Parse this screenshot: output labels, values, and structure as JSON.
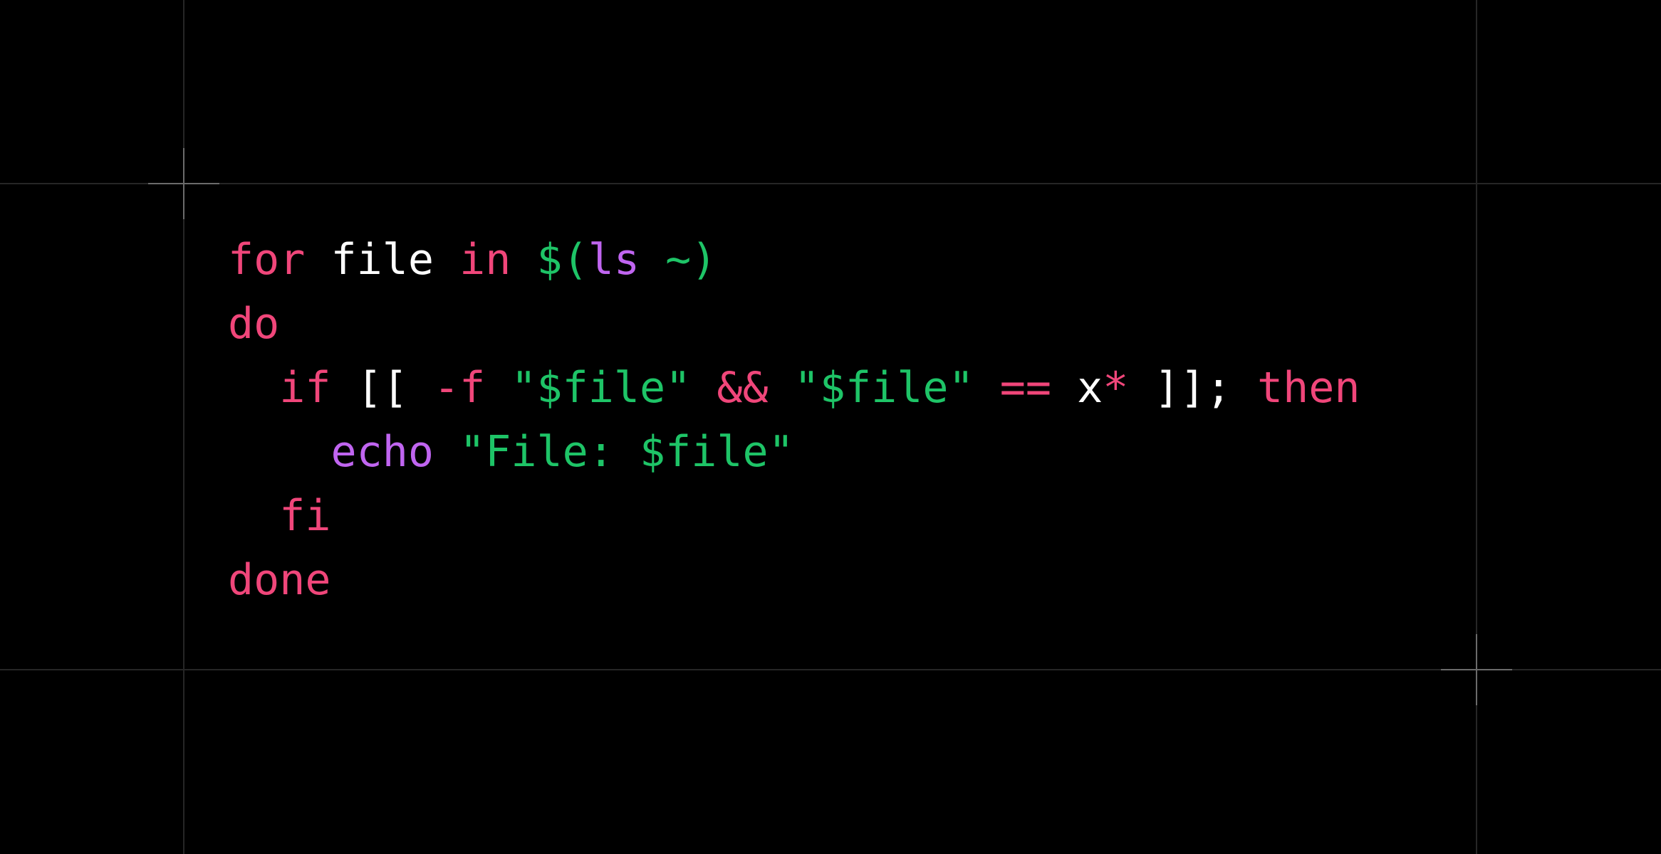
{
  "colors": {
    "background": "#000000",
    "keyword": "#f0467a",
    "string": "#1ec467",
    "builtin": "#c065f0",
    "plain": "#ffffff",
    "guide": "#262626",
    "crosshair": "#6b6b6b"
  },
  "code": {
    "language": "bash",
    "lines": [
      {
        "tokens": [
          {
            "text": "for",
            "kind": "keyword"
          },
          {
            "text": " ",
            "kind": "plain"
          },
          {
            "text": "file",
            "kind": "plain"
          },
          {
            "text": " ",
            "kind": "plain"
          },
          {
            "text": "in",
            "kind": "keyword"
          },
          {
            "text": " ",
            "kind": "plain"
          },
          {
            "text": "$(",
            "kind": "string"
          },
          {
            "text": "ls",
            "kind": "builtin"
          },
          {
            "text": " ~)",
            "kind": "string"
          }
        ]
      },
      {
        "tokens": [
          {
            "text": "do",
            "kind": "keyword"
          }
        ]
      },
      {
        "tokens": [
          {
            "text": "  ",
            "kind": "plain"
          },
          {
            "text": "if",
            "kind": "keyword"
          },
          {
            "text": " [[ ",
            "kind": "plain"
          },
          {
            "text": "-f",
            "kind": "keyword"
          },
          {
            "text": " ",
            "kind": "plain"
          },
          {
            "text": "\"$file\"",
            "kind": "string"
          },
          {
            "text": " ",
            "kind": "plain"
          },
          {
            "text": "&&",
            "kind": "keyword"
          },
          {
            "text": " ",
            "kind": "plain"
          },
          {
            "text": "\"$file\"",
            "kind": "string"
          },
          {
            "text": " ",
            "kind": "plain"
          },
          {
            "text": "==",
            "kind": "keyword"
          },
          {
            "text": " x",
            "kind": "plain"
          },
          {
            "text": "*",
            "kind": "keyword"
          },
          {
            "text": " ]]; ",
            "kind": "plain"
          },
          {
            "text": "then",
            "kind": "keyword"
          }
        ]
      },
      {
        "tokens": [
          {
            "text": "    ",
            "kind": "plain"
          },
          {
            "text": "echo",
            "kind": "builtin"
          },
          {
            "text": " ",
            "kind": "plain"
          },
          {
            "text": "\"File: $file\"",
            "kind": "string"
          }
        ]
      },
      {
        "tokens": [
          {
            "text": "  ",
            "kind": "plain"
          },
          {
            "text": "fi",
            "kind": "keyword"
          }
        ]
      },
      {
        "tokens": [
          {
            "text": "done",
            "kind": "keyword"
          }
        ]
      }
    ]
  }
}
